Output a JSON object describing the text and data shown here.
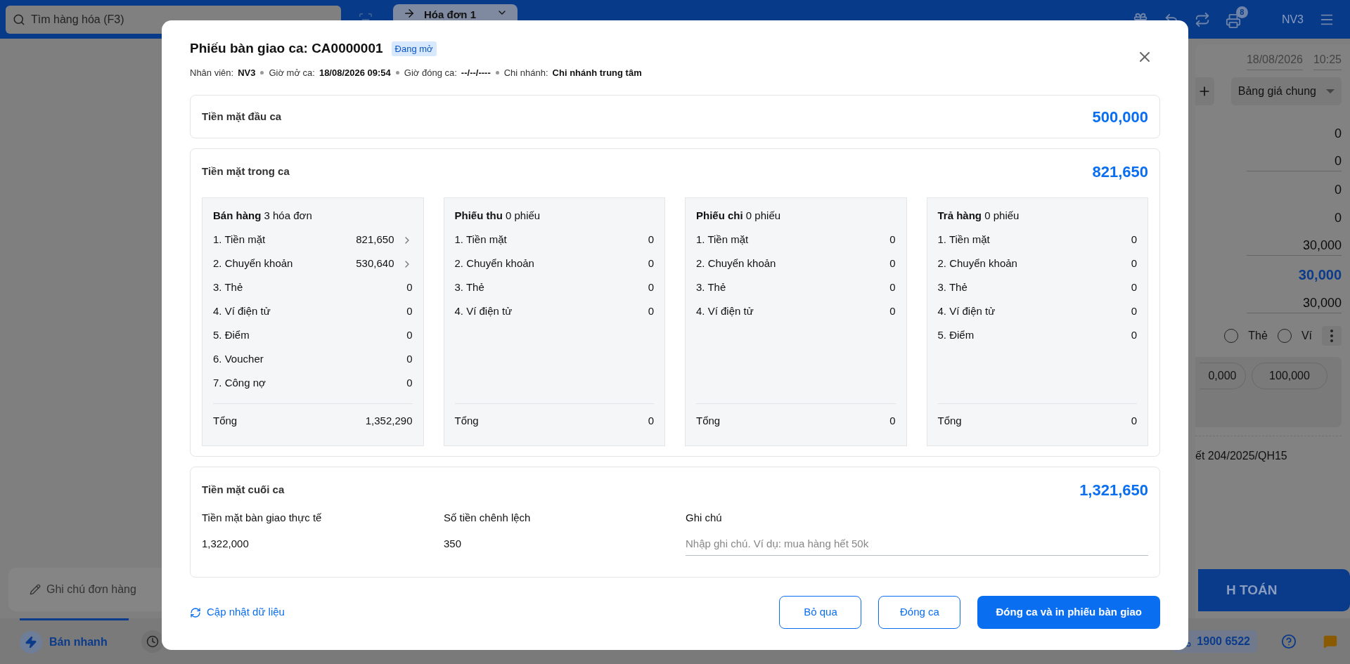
{
  "topbar": {
    "search": {
      "placeholder": "Tìm hàng hóa (F3)"
    },
    "tab": {
      "label": "Hóa đơn 1"
    },
    "printer_badge": "8",
    "user": "NV3"
  },
  "modal": {
    "title": "Phiếu bàn giao ca: CA0000001",
    "status": "Đang mở",
    "meta": [
      {
        "label": "Nhân viên:",
        "value": "NV3"
      },
      {
        "label": "Giờ mở ca:",
        "value": "18/08/2026 09:54"
      },
      {
        "label": "Giờ đóng ca:",
        "value": "--/--/----"
      },
      {
        "label": "Chi nhánh:",
        "value": "Chi nhánh trung tâm"
      }
    ],
    "opening": {
      "label": "Tiền mặt đầu ca",
      "amount": "500,000"
    },
    "during": {
      "label": "Tiền mặt trong ca",
      "amount": "821,650",
      "groups": [
        {
          "title": "Bán hàng",
          "count": "3 hóa đơn",
          "total_label": "Tổng",
          "total": "1,352,290",
          "rows": [
            {
              "label": "1. Tiền mặt",
              "value": "821,650",
              "expandable": true
            },
            {
              "label": "2. Chuyển khoản",
              "value": "530,640",
              "expandable": true
            },
            {
              "label": "3. Thẻ",
              "value": "0",
              "expandable": false
            },
            {
              "label": "4. Ví điện tử",
              "value": "0",
              "expandable": false
            },
            {
              "label": "5. Điểm",
              "value": "0",
              "expandable": false
            },
            {
              "label": "6. Voucher",
              "value": "0",
              "expandable": false
            },
            {
              "label": "7. Công nợ",
              "value": "0",
              "expandable": false
            }
          ]
        },
        {
          "title": "Phiếu thu",
          "count": "0 phiếu",
          "total_label": "Tổng",
          "total": "0",
          "rows": [
            {
              "label": "1. Tiền mặt",
              "value": "0",
              "expandable": false
            },
            {
              "label": "2. Chuyển khoản",
              "value": "0",
              "expandable": false
            },
            {
              "label": "3. Thẻ",
              "value": "0",
              "expandable": false
            },
            {
              "label": "4. Ví điện tử",
              "value": "0",
              "expandable": false
            }
          ]
        },
        {
          "title": "Phiếu chi",
          "count": "0 phiếu",
          "total_label": "Tổng",
          "total": "0",
          "rows": [
            {
              "label": "1. Tiền mặt",
              "value": "0",
              "expandable": false
            },
            {
              "label": "2. Chuyển khoản",
              "value": "0",
              "expandable": false
            },
            {
              "label": "3. Thẻ",
              "value": "0",
              "expandable": false
            },
            {
              "label": "4. Ví điện tử",
              "value": "0",
              "expandable": false
            }
          ]
        },
        {
          "title": "Trả hàng",
          "count": "0 phiếu",
          "total_label": "Tổng",
          "total": "0",
          "rows": [
            {
              "label": "1. Tiền mặt",
              "value": "0",
              "expandable": false
            },
            {
              "label": "2. Chuyển khoản",
              "value": "0",
              "expandable": false
            },
            {
              "label": "3. Thẻ",
              "value": "0",
              "expandable": false
            },
            {
              "label": "4. Ví điện tử",
              "value": "0",
              "expandable": false
            },
            {
              "label": "5. Điểm",
              "value": "0",
              "expandable": false
            }
          ]
        }
      ]
    },
    "closing": {
      "label": "Tiền mặt cuối ca",
      "amount": "1,321,650",
      "fields": [
        {
          "label": "Tiền mặt bàn giao thực tế",
          "value": "1,322,000"
        },
        {
          "label": "Số tiền chênh lệch",
          "value": "350"
        }
      ],
      "note": {
        "label": "Ghi chú",
        "placeholder": "Nhập ghi chú. Ví dụ: mua hàng hết 50k"
      }
    },
    "refresh": "Cập nhật dữ liệu",
    "buttons": [
      {
        "label": "Bỏ qua",
        "kind": "outline"
      },
      {
        "label": "Đóng ca",
        "kind": "outline"
      },
      {
        "label": "Đóng ca và in phiếu bàn giao",
        "kind": "primary"
      }
    ]
  },
  "panel": {
    "date": "18/08/2026",
    "time": "10:25",
    "price_list": "Bảng giá chung",
    "values": [
      {
        "value": "0",
        "kind": "plain"
      },
      {
        "value": "0",
        "kind": "input"
      },
      {
        "value": "0",
        "kind": "plain"
      },
      {
        "value": "0",
        "kind": "plain"
      },
      {
        "value": "30,000",
        "kind": "input"
      },
      {
        "value": "30,000",
        "kind": "total"
      },
      {
        "value": "30,000",
        "kind": "input"
      }
    ],
    "payment_methods": [
      {
        "label": "Thẻ",
        "selected": false
      },
      {
        "label": "Ví",
        "selected": false
      }
    ],
    "quick_amounts": [
      "0,000",
      "100,000"
    ],
    "legal_note": "ết 204/2025/QH15",
    "pay_button": "H TOÁN"
  },
  "bottom": {
    "note_button": "Ghi chú đơn hàng",
    "tabs": [
      {
        "label": "Bán nhanh",
        "selected": true
      }
    ],
    "hotline": "1900 6522"
  }
}
